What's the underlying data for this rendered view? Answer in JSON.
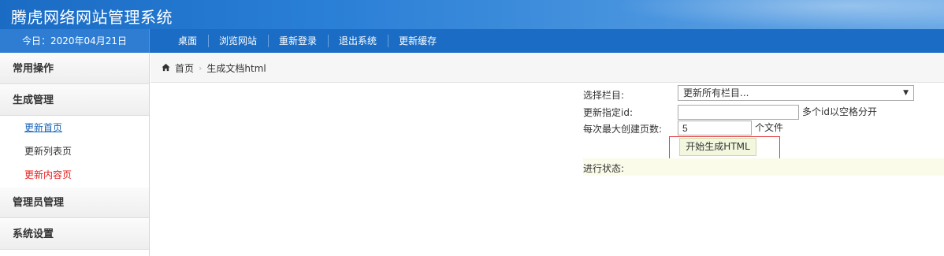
{
  "app": {
    "title": "腾虎网络网站管理系统"
  },
  "navbar": {
    "date": "今日：2020年04月21日",
    "items": [
      "桌面",
      "浏览网站",
      "重新登录",
      "退出系统",
      "更新缓存"
    ]
  },
  "sidebar": {
    "sections": [
      {
        "label": "常用操作"
      },
      {
        "label": "生成管理",
        "items": [
          "更新首页",
          "更新列表页",
          "更新内容页"
        ]
      },
      {
        "label": "管理员管理"
      },
      {
        "label": "系统设置"
      }
    ]
  },
  "breadcrumb": {
    "home": "首页",
    "current": "生成文档html"
  },
  "form": {
    "column_label": "选择栏目:",
    "column_selected": "更新所有栏目...",
    "id_label": "更新指定id:",
    "id_value": "",
    "id_hint": "多个id以空格分开",
    "max_pages_label": "每次最大创建页数:",
    "max_pages_value": "5",
    "max_pages_unit": "个文件",
    "generate_button": "开始生成HTML",
    "status_label": "进行状态:"
  },
  "colors": {
    "header_blue": "#1a6cc4",
    "active_link": "#1a64b8",
    "alert_red": "#e41c1c",
    "frame_red": "#e23b3b",
    "button_bg": "#f2f7de"
  }
}
